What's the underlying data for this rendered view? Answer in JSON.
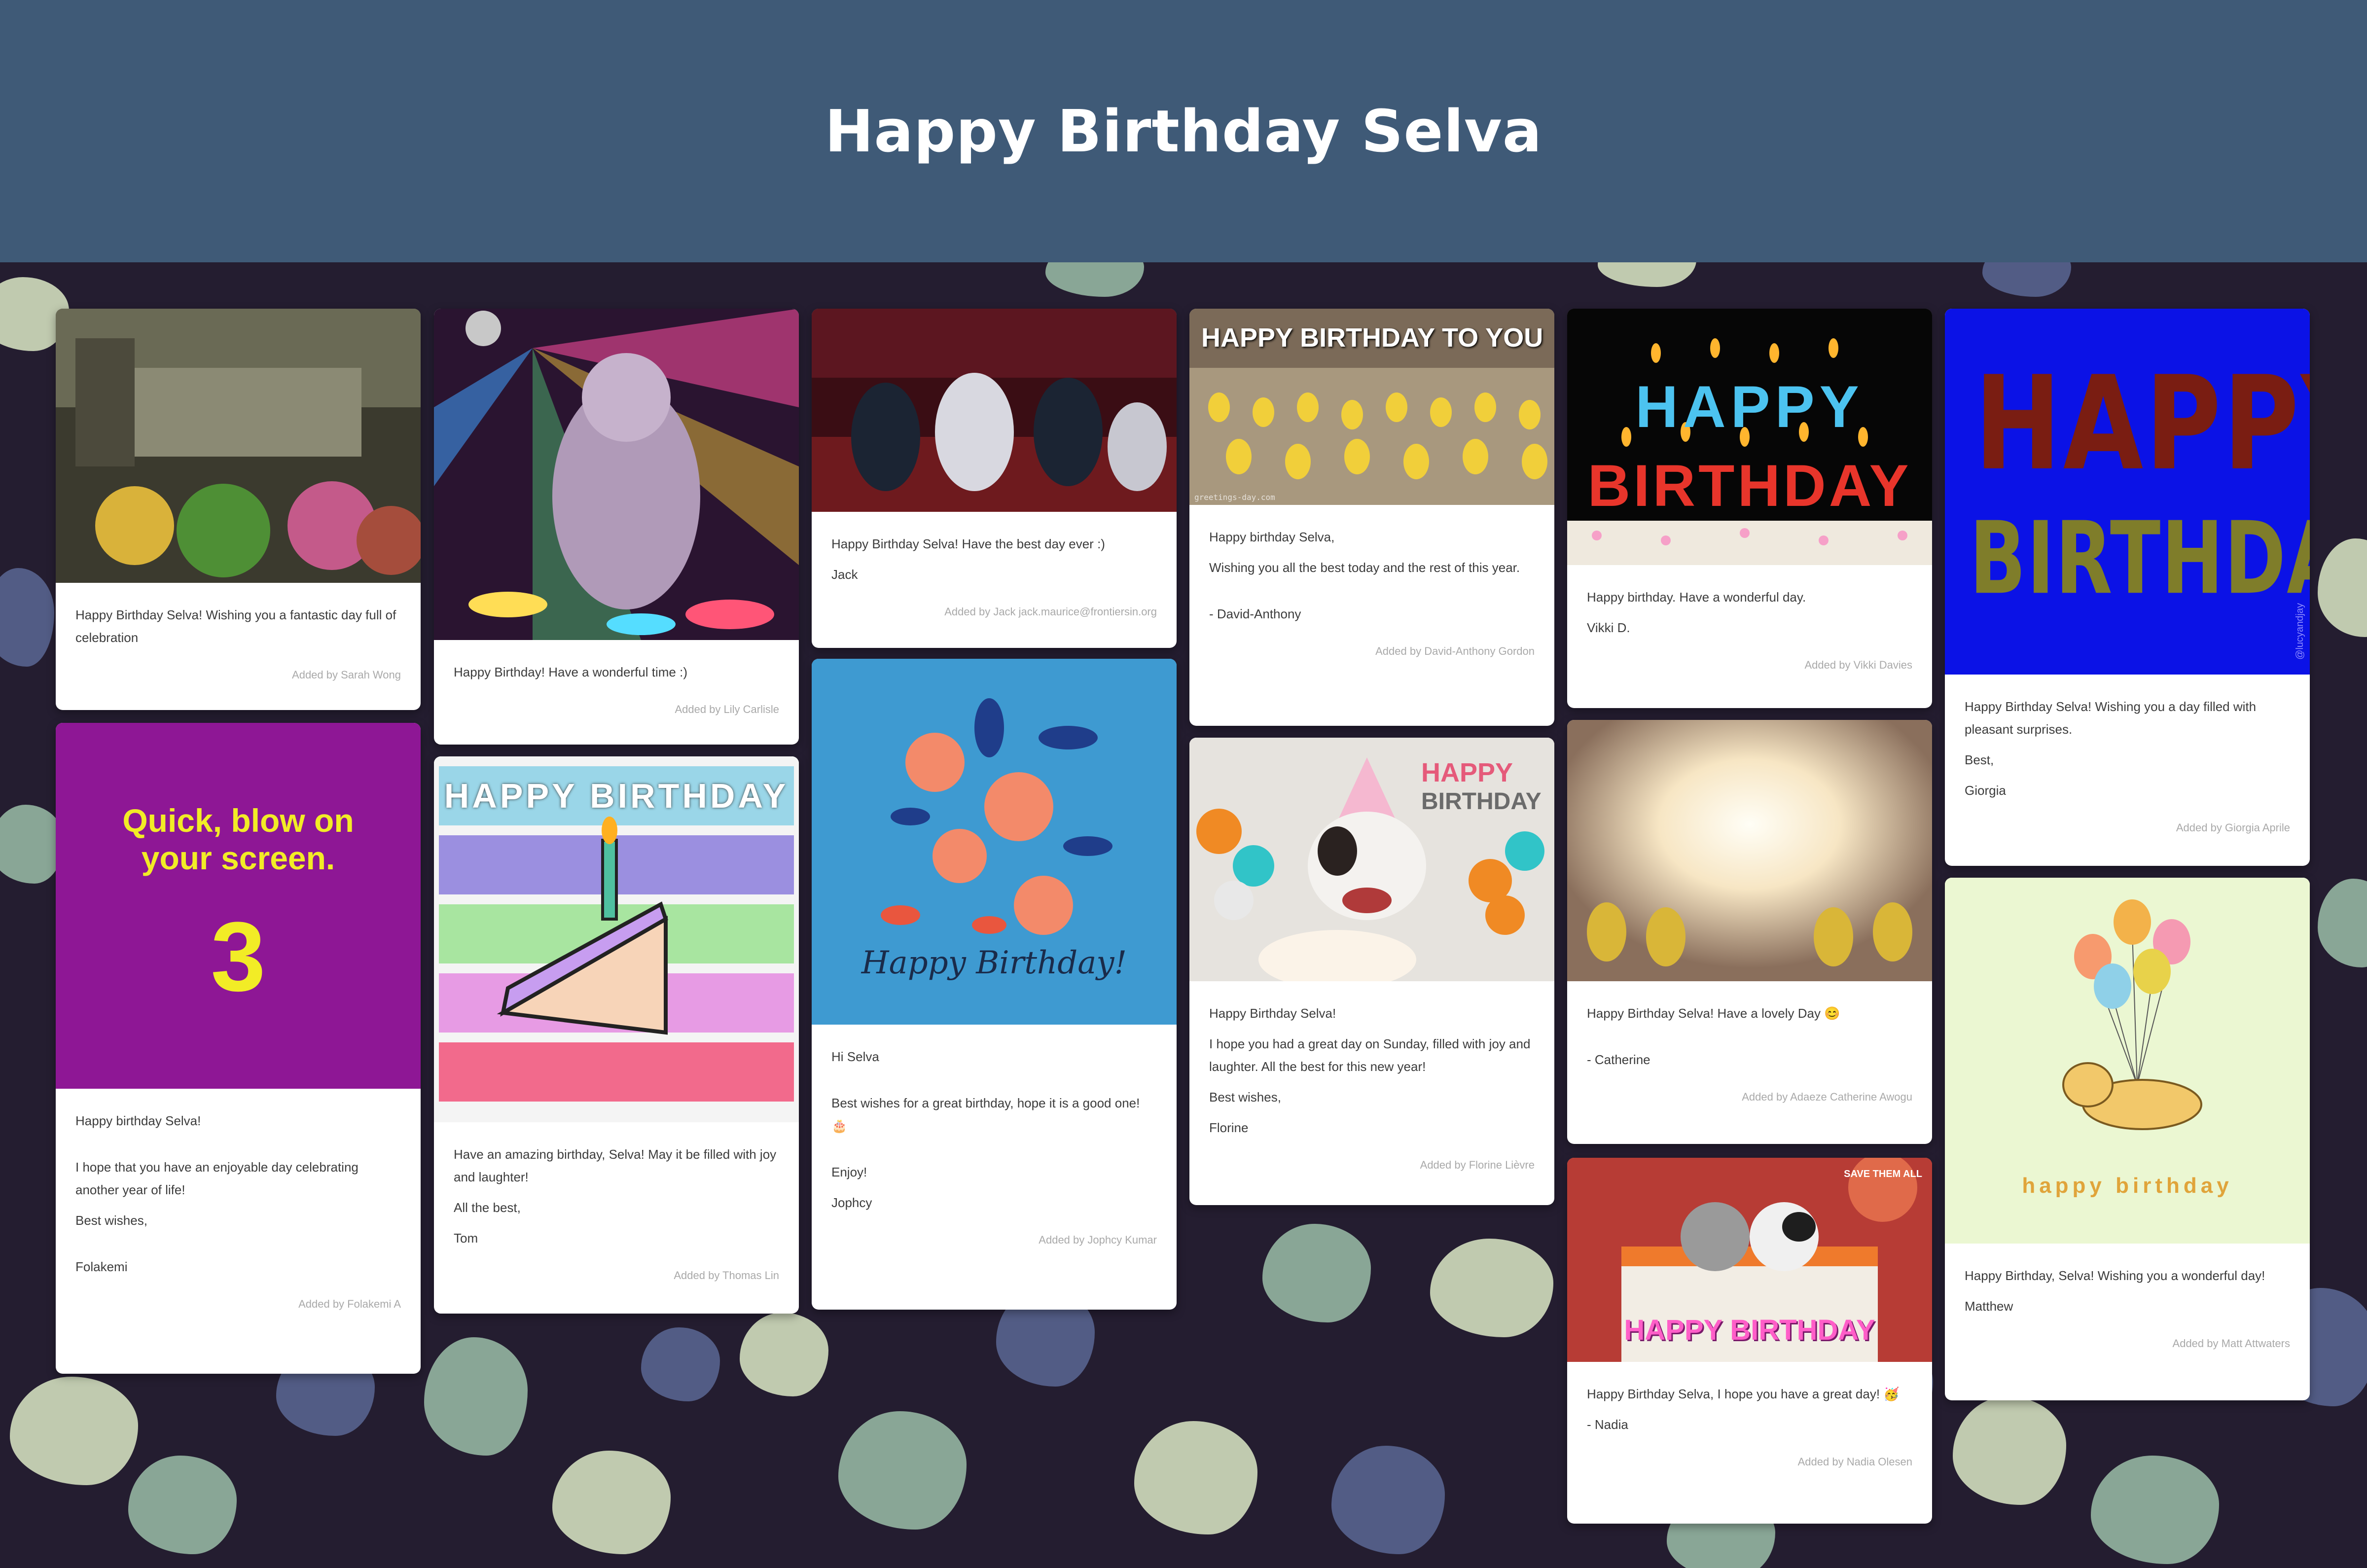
{
  "header": {
    "title": "Happy Birthday Selva"
  },
  "cards": {
    "c1": {
      "lines": [
        "Happy Birthday Selva! Wishing you a fantastic day full of celebration"
      ],
      "added": "Added by Sarah Wong"
    },
    "c2": {
      "media_text": [
        "Quick, blow on",
        "your screen.",
        "3"
      ],
      "lines": [
        "Happy birthday Selva!",
        "I hope that you have an enjoyable day celebrating another year of life!",
        "Best wishes,",
        "Folakemi"
      ],
      "added": "Added by Folakemi A"
    },
    "c3": {
      "lines": [
        "Happy Birthday! Have a wonderful time :)"
      ],
      "added": "Added by Lily Carlisle"
    },
    "c4": {
      "media_text": [
        "HAPPY BIRTHDAY"
      ],
      "lines": [
        "Have an amazing birthday, Selva! May it be filled with joy and laughter!",
        "All the best,",
        "Tom"
      ],
      "added": "Added by Thomas Lin"
    },
    "c5": {
      "lines": [
        "Happy Birthday Selva! Have the best day ever :)",
        "Jack"
      ],
      "added": "Added by Jack jack.maurice@frontiersin.org"
    },
    "c6": {
      "media_text": [
        "Happy Birthday!"
      ],
      "lines": [
        "Hi Selva",
        "Best wishes for a great birthday, hope it is a good one! 🎂",
        "Enjoy!",
        "Jophcy"
      ],
      "added": "Added by Jophcy Kumar"
    },
    "c7": {
      "media_text": [
        "HAPPY BIRTHDAY TO YOU",
        "greetings-day.com"
      ],
      "lines": [
        "Happy birthday Selva,",
        "Wishing you all the best today and the rest of this year.",
        "- David-Anthony"
      ],
      "added": "Added by David-Anthony Gordon"
    },
    "c8": {
      "media_text": [
        "HAPPY",
        "BIRTHDAY"
      ],
      "lines": [
        "Happy Birthday Selva!",
        "I hope you had a great day on Sunday, filled with joy and laughter. All the best for this new year!",
        "Best wishes,",
        "Florine"
      ],
      "added": "Added by Florine Lièvre"
    },
    "c9": {
      "media_text": [
        "HAPPY",
        "BIRTHDAY"
      ],
      "lines": [
        "Happy birthday. Have a wonderful day.",
        "Vikki D."
      ],
      "added": "Added by Vikki Davies"
    },
    "c10": {
      "lines": [
        "Happy Birthday Selva! Have a lovely Day 😊",
        "- Catherine"
      ],
      "added": "Added by Adaeze Catherine Awogu"
    },
    "c11": {
      "media_text": [
        "HAPPY BIRTHDAY",
        "SAVE THEM ALL"
      ],
      "lines": [
        "Happy Birthday Selva, I hope you have a great day! 🥳",
        "- Nadia"
      ],
      "added": "Added by Nadia Olesen"
    },
    "c12": {
      "media_text": [
        "HAPPY",
        "BIRTHDAY",
        "@lucyandjay"
      ],
      "lines": [
        "Happy Birthday Selva! Wishing you a day filled with pleasant surprises.",
        "Best,",
        "Giorgia"
      ],
      "added": "Added by Giorgia Aprile"
    },
    "c13": {
      "media_text": [
        "happy birthday"
      ],
      "lines": [
        "Happy Birthday, Selva! Wishing you a wonderful day!",
        "Matthew"
      ],
      "added": "Added by Matt Attwaters"
    }
  },
  "colors": {
    "header_bg": "#3f5a77",
    "board_bg": "#241d30",
    "leaf_green": "#8fae9c",
    "leaf_light": "#c9d4b6",
    "leaf_blue": "#55608a"
  }
}
